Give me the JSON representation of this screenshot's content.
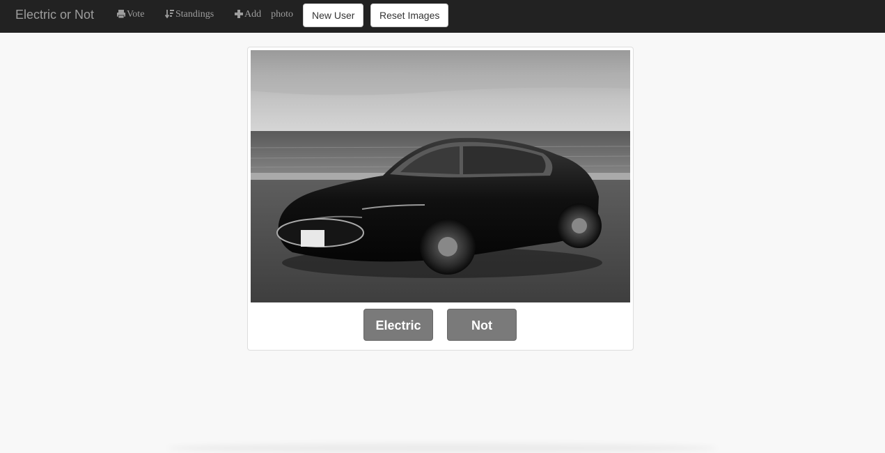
{
  "navbar": {
    "brand": "Electric or Not",
    "links": [
      {
        "icon": "print-icon",
        "label": "Vote"
      },
      {
        "icon": "sort-icon",
        "label": "Standings"
      },
      {
        "icon": "plus-icon",
        "label_1": "Add",
        "label_2": "photo"
      }
    ],
    "buttons": {
      "new_user": "New User",
      "reset_images": "Reset Images"
    }
  },
  "card": {
    "image": {
      "subject": "car-photo",
      "style": "grayscale"
    },
    "vote_buttons": {
      "electric": "Electric",
      "not": "Not"
    }
  },
  "colors": {
    "navbar_bg": "#222222",
    "nav_text": "#9d9d9d",
    "page_bg": "#f8f8f8",
    "vote_button_bg": "#7a7a7a"
  }
}
